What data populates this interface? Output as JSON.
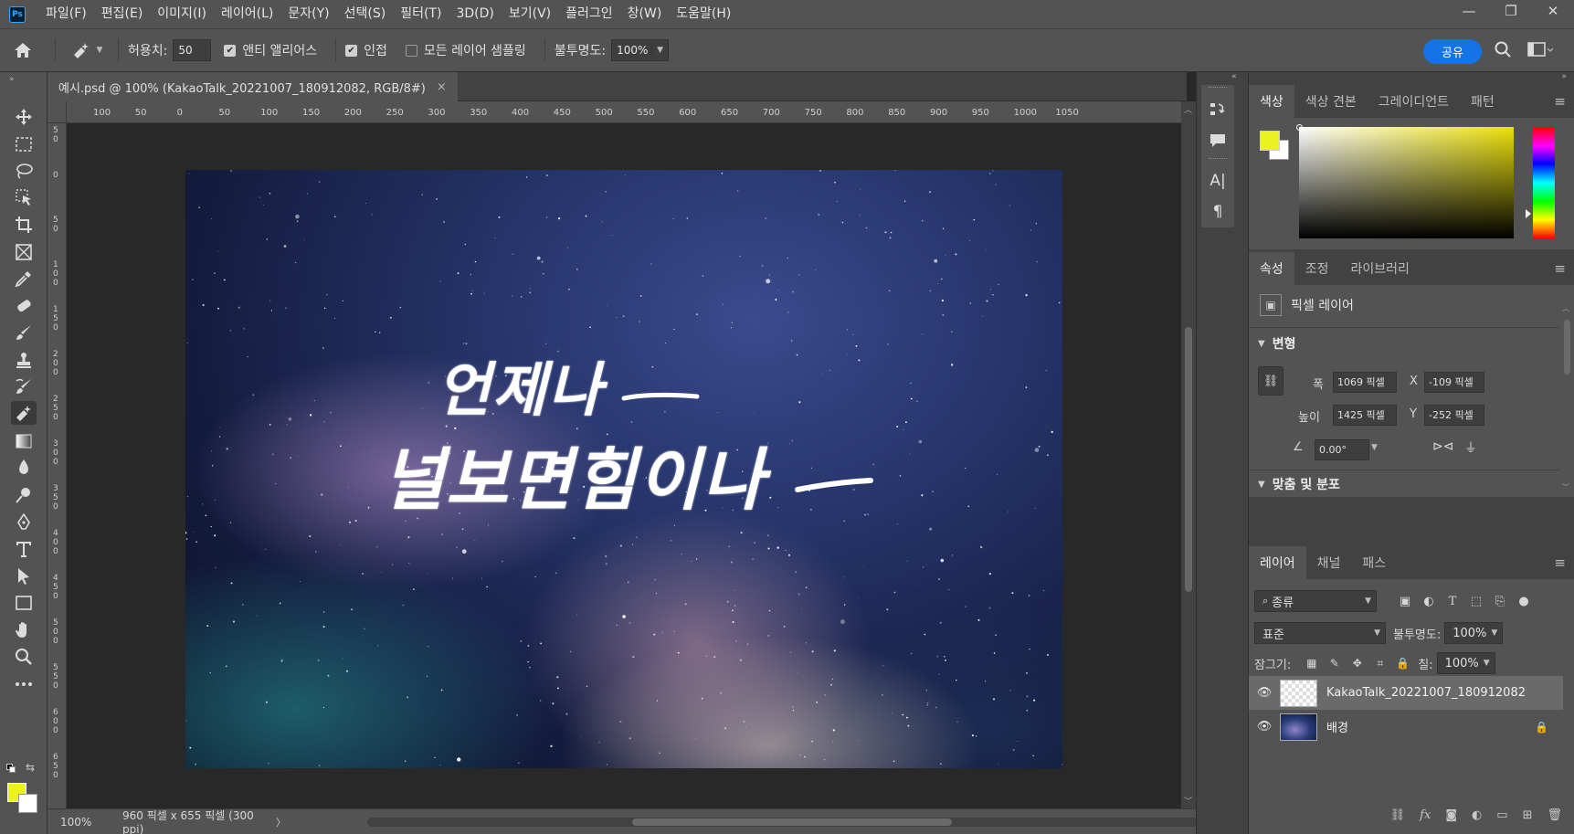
{
  "app": {
    "logo": "Ps",
    "accent": "#31a8ff"
  },
  "menu": [
    "파일(F)",
    "편집(E)",
    "이미지(I)",
    "레이어(L)",
    "문자(Y)",
    "선택(S)",
    "필터(T)",
    "3D(D)",
    "보기(V)",
    "플러그인",
    "창(W)",
    "도움말(H)"
  ],
  "window_controls": {
    "minimize": "—",
    "maximize": "❐",
    "close": "✕"
  },
  "options": {
    "tolerance_label": "허용치:",
    "tolerance_value": "50",
    "antialias_label": "앤티 앨리어스",
    "antialias_checked": true,
    "contiguous_label": "인접",
    "contiguous_checked": true,
    "sample_all_label": "모든 레이어 샘플링",
    "sample_all_checked": false,
    "opacity_label": "불투명도:",
    "opacity_value": "100%",
    "share_label": "공유"
  },
  "document": {
    "tab_title": "예시.psd @ 100% (KakaoTalk_20221007_180912082, RGB/8#)",
    "close_glyph": "×",
    "ruler_h": [
      "100",
      "50",
      "0",
      "50",
      "100",
      "150",
      "200",
      "250",
      "300",
      "350",
      "400",
      "450",
      "500",
      "550",
      "600",
      "650",
      "700",
      "750",
      "800",
      "850",
      "900",
      "950",
      "1000",
      "1050"
    ],
    "ruler_v": [
      "5\n0",
      "0",
      "5\n0",
      "1\n0\n0",
      "1\n5\n0",
      "2\n0\n0",
      "2\n5\n0",
      "3\n0\n0",
      "3\n5\n0",
      "4\n0\n0",
      "4\n5\n0",
      "5\n0\n0",
      "5\n5\n0",
      "6\n0\n0",
      "6\n5\n0"
    ],
    "artwork_line1": "언제나",
    "artwork_line2": "널보면힘이나"
  },
  "status": {
    "zoom": "100%",
    "size": "960 픽셀 x 655 픽셀 (300 ppi)",
    "arrow": "〉"
  },
  "colors": {
    "foreground": "#ebf21f",
    "background": "#ffffff"
  },
  "panels": {
    "color_tabs": [
      "색상",
      "색상 견본",
      "그레이디언트",
      "패턴"
    ],
    "props_tabs": [
      "속성",
      "조정",
      "라이브러리"
    ],
    "props": {
      "layer_type": "픽셀 레이어",
      "transform_title": "변형",
      "width_label": "폭",
      "width_value": "1069 픽셀",
      "height_label": "높이",
      "height_value": "1425 픽셀",
      "x_label": "X",
      "x_value": "-109 픽셀",
      "y_label": "Y",
      "y_value": "-252 픽셀",
      "angle_value": "0.00°",
      "align_title": "맞춤 및 분포"
    },
    "layers_tabs": [
      "레이어",
      "채널",
      "패스"
    ],
    "layers": {
      "filter_kind": "종류",
      "blend_mode": "표준",
      "opacity_label": "불투명도:",
      "opacity_value": "100%",
      "lock_label": "잠그기:",
      "fill_label": "칠:",
      "fill_value": "100%",
      "items": [
        {
          "name": "KakaoTalk_20221007_180912082",
          "visible": true,
          "selected": true
        },
        {
          "name": "배경",
          "visible": true,
          "selected": false,
          "locked": true
        }
      ]
    }
  },
  "icons": {
    "home": "home-icon",
    "magic_eraser": "magic-eraser-icon",
    "search": "search-icon",
    "workspace": "workspace-icon",
    "tools": [
      "move-icon",
      "marquee-icon",
      "lasso-icon",
      "object-select-icon",
      "crop-icon",
      "frame-icon",
      "eyedropper-icon",
      "healing-icon",
      "brush-icon",
      "stamp-icon",
      "history-brush-icon",
      "eraser-icon",
      "gradient-icon",
      "blur-icon",
      "dodge-icon",
      "pen-icon",
      "type-icon",
      "path-select-icon",
      "rectangle-icon",
      "hand-icon",
      "zoom-icon",
      "more-icon"
    ]
  }
}
